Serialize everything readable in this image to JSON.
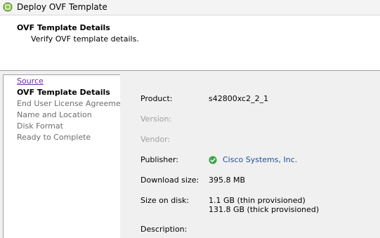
{
  "window": {
    "title": "Deploy OVF Template",
    "icon": "vmware-logo-icon"
  },
  "header": {
    "title": "OVF Template Details",
    "subtitle": "Verify OVF template details."
  },
  "sidebar": {
    "items": [
      {
        "label": "Source",
        "state": "link"
      },
      {
        "label": "OVF Template Details",
        "state": "current"
      },
      {
        "label": "End User License Agreement",
        "state": "disabled"
      },
      {
        "label": "Name and Location",
        "state": "disabled"
      },
      {
        "label": "Disk Format",
        "state": "disabled"
      },
      {
        "label": "Ready to Complete",
        "state": "disabled"
      }
    ]
  },
  "details": {
    "product_label": "Product:",
    "product_value": "s42800xc2_2_1",
    "version_label": "Version:",
    "vendor_label": "Vendor:",
    "publisher_label": "Publisher:",
    "publisher_value": "Cisco Systems, Inc.",
    "publisher_icon": "verified-check-icon",
    "download_size_label": "Download size:",
    "download_size_value": "395.8 MB",
    "size_on_disk_label": "Size on disk:",
    "size_on_disk_thin": "1.1 GB (thin provisioned)",
    "size_on_disk_thick": "131.8 GB (thick provisioned)",
    "description_label": "Description:"
  },
  "colors": {
    "link": "#6a2ca6",
    "publisher_link": "#1f4f9e",
    "check_green": "#3aa64a",
    "disabled_text": "#6d6d6d"
  }
}
